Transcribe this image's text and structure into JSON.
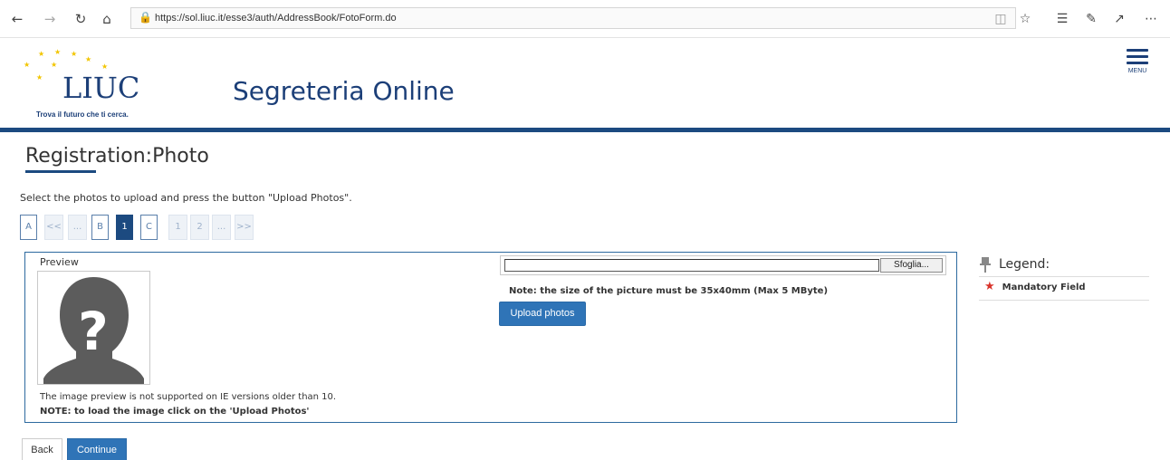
{
  "browser": {
    "url": "https://sol.liuc.it/esse3/auth/AddressBook/FotoForm.do",
    "icons": [
      "back-icon",
      "forward-icon",
      "refresh-icon",
      "home-icon",
      "lock-icon",
      "reading-view-icon",
      "favorite-star-icon",
      "favorites-list-icon",
      "pen-icon",
      "share-icon",
      "more-icon"
    ]
  },
  "header": {
    "logo_text": "LIUC",
    "tagline": "Trova il futuro che ti cerca.",
    "site_title": "Segreteria Online",
    "menu_label": "MENU",
    "brand_color": "#1c3f78",
    "star_color": "#f2c500"
  },
  "page": {
    "title": "Registration:Photo",
    "instructions": "Select the photos to upload and press the button \"Upload Photos\"."
  },
  "pagination": {
    "items": [
      "A",
      "<<",
      "...",
      "B",
      "1",
      "C",
      "1",
      "2",
      "...",
      ">>"
    ],
    "active": "1"
  },
  "preview": {
    "label": "Preview",
    "note_ie": "The image preview is not supported on IE versions older than 10.",
    "note_upload": "NOTE: to load the image click on the 'Upload Photos'"
  },
  "upload": {
    "file_value": "",
    "browse_label": "Sfoglia...",
    "size_note": "Note: the size of the picture must be 35x40mm (Max 5 MByte)",
    "upload_label": "Upload photos",
    "button_color": "#2f74b7"
  },
  "legend": {
    "title": "Legend:",
    "items": [
      {
        "symbol": "★",
        "label": "Mandatory Field",
        "color": "#d9332b"
      }
    ]
  },
  "footer": {
    "back_label": "Back",
    "continue_label": "Continue"
  }
}
